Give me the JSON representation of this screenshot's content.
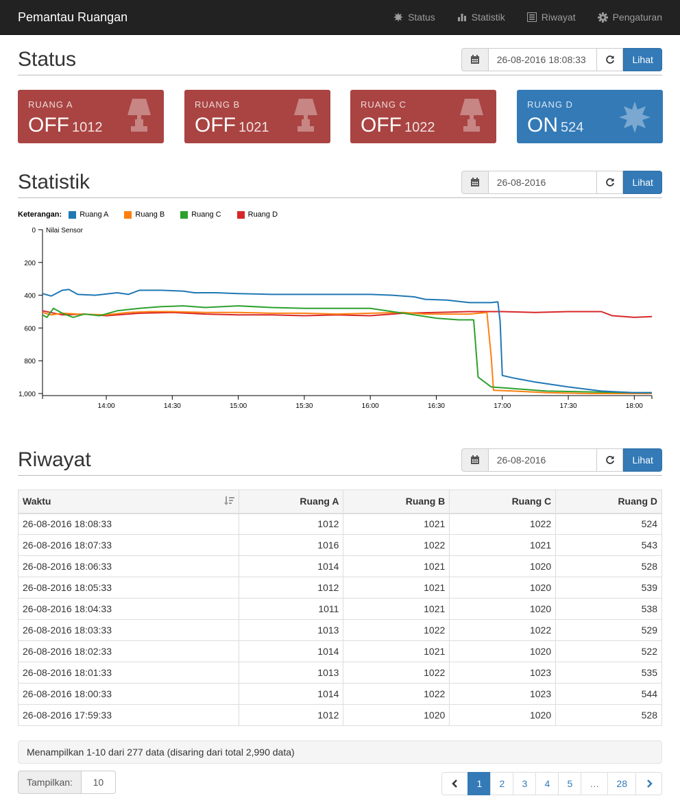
{
  "navbar": {
    "brand": "Pemantau Ruangan",
    "items": [
      {
        "label": "Status",
        "icon": "sun-icon"
      },
      {
        "label": "Statistik",
        "icon": "bar-chart-icon"
      },
      {
        "label": "Riwayat",
        "icon": "list-icon"
      },
      {
        "label": "Pengaturan",
        "icon": "gear-icon"
      }
    ]
  },
  "status": {
    "title": "Status",
    "datetime": "26-08-2016 18:08:33",
    "button": "Lihat",
    "rooms": [
      {
        "name": "RUANG A",
        "state": "OFF",
        "value": "1012",
        "icon": "lamp-icon",
        "color": "#a94442"
      },
      {
        "name": "RUANG B",
        "state": "OFF",
        "value": "1021",
        "icon": "lamp-icon",
        "color": "#a94442"
      },
      {
        "name": "RUANG C",
        "state": "OFF",
        "value": "1022",
        "icon": "lamp-icon",
        "color": "#a94442"
      },
      {
        "name": "RUANG D",
        "state": "ON",
        "value": "524",
        "icon": "sun-icon",
        "color": "#337ab7"
      }
    ]
  },
  "statistik": {
    "title": "Statistik",
    "date": "26-08-2016",
    "button": "Lihat",
    "legend_label": "Keterangan:"
  },
  "chart_data": {
    "type": "line",
    "ylabel": "Nilai Sensor",
    "ylim": [
      0,
      1000
    ],
    "y_reversed": true,
    "yticks": [
      "0",
      "200",
      "400",
      "600",
      "800",
      "1,000"
    ],
    "xticks": [
      "14:00",
      "14:30",
      "15:00",
      "15:30",
      "16:00",
      "16:30",
      "17:00",
      "17:30",
      "18:00"
    ],
    "xlim": [
      "13:31",
      "18:08"
    ],
    "grid": false,
    "legend_position": "top-left",
    "series": [
      {
        "name": "Ruang A",
        "color": "#1f77b4",
        "points": [
          [
            "13:31",
            390
          ],
          [
            "13:35",
            405
          ],
          [
            "13:40",
            370
          ],
          [
            "13:43",
            365
          ],
          [
            "13:47",
            395
          ],
          [
            "13:55",
            400
          ],
          [
            "14:05",
            385
          ],
          [
            "14:10",
            395
          ],
          [
            "14:15",
            370
          ],
          [
            "14:25",
            370
          ],
          [
            "14:35",
            375
          ],
          [
            "14:40",
            385
          ],
          [
            "14:50",
            385
          ],
          [
            "15:00",
            390
          ],
          [
            "15:15",
            395
          ],
          [
            "15:30",
            395
          ],
          [
            "15:45",
            395
          ],
          [
            "16:00",
            395
          ],
          [
            "16:10",
            400
          ],
          [
            "16:20",
            410
          ],
          [
            "16:25",
            425
          ],
          [
            "16:35",
            430
          ],
          [
            "16:45",
            445
          ],
          [
            "16:55",
            445
          ],
          [
            "16:58",
            440
          ],
          [
            "16:59",
            560
          ],
          [
            "17:00",
            890
          ],
          [
            "17:05",
            905
          ],
          [
            "17:15",
            930
          ],
          [
            "17:30",
            960
          ],
          [
            "17:45",
            985
          ],
          [
            "18:00",
            995
          ],
          [
            "18:08",
            995
          ]
        ]
      },
      {
        "name": "Ruang B",
        "color": "#ff7f0e",
        "points": [
          [
            "13:31",
            505
          ],
          [
            "13:35",
            520
          ],
          [
            "13:40",
            510
          ],
          [
            "13:47",
            515
          ],
          [
            "14:00",
            520
          ],
          [
            "14:10",
            505
          ],
          [
            "14:20",
            500
          ],
          [
            "14:30",
            500
          ],
          [
            "14:45",
            505
          ],
          [
            "15:00",
            505
          ],
          [
            "15:15",
            510
          ],
          [
            "15:30",
            510
          ],
          [
            "15:45",
            515
          ],
          [
            "16:00",
            510
          ],
          [
            "16:15",
            505
          ],
          [
            "16:25",
            515
          ],
          [
            "16:35",
            515
          ],
          [
            "16:45",
            515
          ],
          [
            "16:53",
            505
          ],
          [
            "16:55",
            780
          ],
          [
            "16:56",
            980
          ],
          [
            "17:05",
            985
          ],
          [
            "17:20",
            995
          ],
          [
            "17:40",
            1000
          ],
          [
            "18:00",
            1000
          ],
          [
            "18:08",
            1000
          ]
        ]
      },
      {
        "name": "Ruang C",
        "color": "#2ca02c",
        "points": [
          [
            "13:31",
            520
          ],
          [
            "13:33",
            535
          ],
          [
            "13:36",
            480
          ],
          [
            "13:40",
            510
          ],
          [
            "13:45",
            535
          ],
          [
            "13:50",
            515
          ],
          [
            "13:57",
            525
          ],
          [
            "14:05",
            495
          ],
          [
            "14:15",
            480
          ],
          [
            "14:25",
            470
          ],
          [
            "14:35",
            465
          ],
          [
            "14:45",
            475
          ],
          [
            "15:00",
            465
          ],
          [
            "15:15",
            475
          ],
          [
            "15:30",
            480
          ],
          [
            "15:45",
            480
          ],
          [
            "16:00",
            480
          ],
          [
            "16:10",
            500
          ],
          [
            "16:20",
            520
          ],
          [
            "16:30",
            540
          ],
          [
            "16:40",
            550
          ],
          [
            "16:47",
            550
          ],
          [
            "16:49",
            900
          ],
          [
            "16:55",
            960
          ],
          [
            "17:05",
            970
          ],
          [
            "17:20",
            985
          ],
          [
            "17:40",
            990
          ],
          [
            "18:00",
            995
          ],
          [
            "18:08",
            995
          ]
        ]
      },
      {
        "name": "Ruang D",
        "color": "#d62728",
        "points": [
          [
            "13:31",
            495
          ],
          [
            "13:40",
            520
          ],
          [
            "13:50",
            515
          ],
          [
            "14:00",
            525
          ],
          [
            "14:15",
            510
          ],
          [
            "14:30",
            505
          ],
          [
            "14:45",
            515
          ],
          [
            "15:00",
            520
          ],
          [
            "15:15",
            520
          ],
          [
            "15:30",
            525
          ],
          [
            "15:45",
            520
          ],
          [
            "16:00",
            525
          ],
          [
            "16:15",
            510
          ],
          [
            "16:30",
            505
          ],
          [
            "16:45",
            500
          ],
          [
            "17:00",
            500
          ],
          [
            "17:15",
            505
          ],
          [
            "17:30",
            500
          ],
          [
            "17:45",
            500
          ],
          [
            "17:50",
            525
          ],
          [
            "18:00",
            535
          ],
          [
            "18:08",
            530
          ]
        ]
      }
    ]
  },
  "riwayat": {
    "title": "Riwayat",
    "date": "26-08-2016",
    "button": "Lihat",
    "columns": [
      "Waktu",
      "Ruang A",
      "Ruang B",
      "Ruang C",
      "Ruang D"
    ],
    "rows": [
      [
        "26-08-2016 18:08:33",
        "1012",
        "1021",
        "1022",
        "524"
      ],
      [
        "26-08-2016 18:07:33",
        "1016",
        "1022",
        "1021",
        "543"
      ],
      [
        "26-08-2016 18:06:33",
        "1014",
        "1021",
        "1020",
        "528"
      ],
      [
        "26-08-2016 18:05:33",
        "1012",
        "1021",
        "1020",
        "539"
      ],
      [
        "26-08-2016 18:04:33",
        "1011",
        "1021",
        "1020",
        "538"
      ],
      [
        "26-08-2016 18:03:33",
        "1013",
        "1022",
        "1022",
        "529"
      ],
      [
        "26-08-2016 18:02:33",
        "1014",
        "1021",
        "1020",
        "522"
      ],
      [
        "26-08-2016 18:01:33",
        "1013",
        "1022",
        "1023",
        "535"
      ],
      [
        "26-08-2016 18:00:33",
        "1014",
        "1022",
        "1023",
        "544"
      ],
      [
        "26-08-2016 17:59:33",
        "1012",
        "1020",
        "1020",
        "528"
      ]
    ],
    "info": "Menampilkan 1-10 dari 277 data (disaring dari total 2,990 data)",
    "show_label": "Tampilkan:",
    "show_value": "10",
    "pages": [
      "1",
      "2",
      "3",
      "4",
      "5",
      "…",
      "28"
    ],
    "active_page": "1"
  }
}
